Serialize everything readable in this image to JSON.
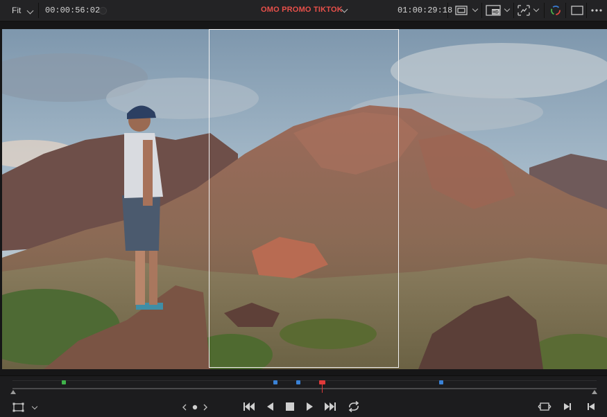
{
  "topbar": {
    "fit_label": "Fit",
    "timecode_left": "00:00:56:02",
    "title": "OMO PROMO TIKTOK",
    "timecode_right": "01:00:29:18",
    "title_color": "#e8504a"
  },
  "icons": {
    "zoom_chevron": "chevron-down-icon",
    "safe_area": "viewer-frame-icon",
    "hd_output": "hd-monitor-icon",
    "overlay": "transform-overlay-icon",
    "color": "color-wheel-icon",
    "window": "single-viewer-icon",
    "more": "more-options-icon"
  },
  "scrubber": {
    "markers": [
      {
        "color": "#3fb24a",
        "name": "marker-green"
      },
      {
        "color": "#3a82d6",
        "name": "marker-blue"
      },
      {
        "color": "#3a82d6",
        "name": "marker-blue"
      },
      {
        "color": "#d63a3a",
        "name": "marker-red"
      },
      {
        "color": "#3a82d6",
        "name": "marker-blue"
      }
    ]
  },
  "transport": {
    "buttons": [
      "go-to-start",
      "play-reverse",
      "stop",
      "play",
      "go-to-end",
      "loop"
    ]
  },
  "accent": "#e03a3a"
}
